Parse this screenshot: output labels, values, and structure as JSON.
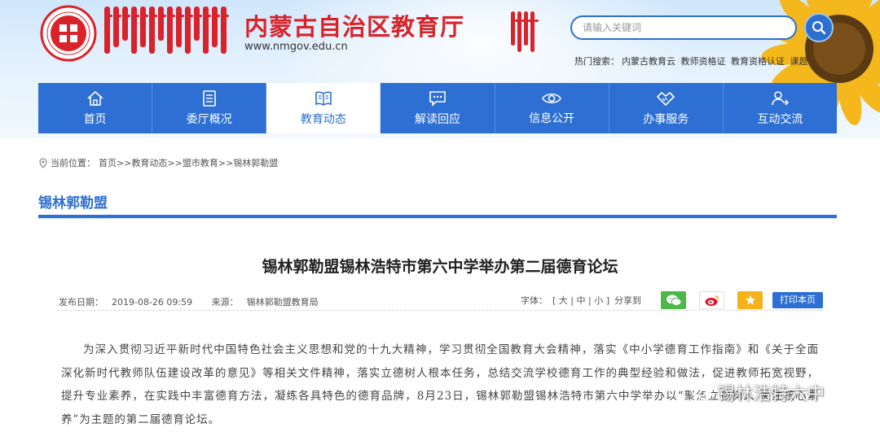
{
  "header": {
    "site_title": "内蒙古自治区教育厅",
    "site_url": "www.nmgov.edu.cn",
    "search_placeholder": "请输入关键词",
    "hot_search_label": "热门搜索：",
    "hot_search_items": [
      "内蒙古教育云",
      "教师资格证",
      "教育资格认证",
      "课题"
    ]
  },
  "nav": {
    "items": [
      {
        "label": "首页",
        "icon": "home-icon"
      },
      {
        "label": "委厅概况",
        "icon": "document-icon"
      },
      {
        "label": "教育动态",
        "icon": "book-icon",
        "active": true
      },
      {
        "label": "解读回应",
        "icon": "chat-icon"
      },
      {
        "label": "信息公开",
        "icon": "eye-icon"
      },
      {
        "label": "办事服务",
        "icon": "handshake-icon"
      },
      {
        "label": "互动交流",
        "icon": "user-exchange-icon"
      }
    ]
  },
  "breadcrumb": {
    "label": "当前位置：",
    "items": [
      "首页",
      ">>",
      "教育动态",
      ">>",
      "盟市教育",
      ">>",
      "锡林郭勒盟"
    ]
  },
  "section": {
    "title": "锡林郭勒盟"
  },
  "article": {
    "title": "锡林郭勒盟锡林浩特市第六中学举办第二届德育论坛",
    "publish_label": "发布日期：",
    "publish_date": "2019-08-26 09:59",
    "source_label": "来源：",
    "source": "锡林郭勒盟教育局",
    "font_label": "字体：",
    "font_sizes": [
      "[",
      "大",
      "|",
      "中",
      "|",
      "小",
      "]"
    ],
    "share_label": "分享到",
    "print_label": "打印本页",
    "paragraph": "为深入贯彻习近平新时代中国特色社会主义思想和党的十九大精神，学习贯彻全国教育大会精神，落实《中小学德育工作指南》和《关于全面深化新时代教师队伍建设改革的意见》等相关文件精神，落实立德树人根本任务，总结交流学校德育工作的典型经验和做法，促进教师拓宽视野，提升专业素养，在实践中丰富德育方法，凝练各具特色的德育品牌，8月23日，锡林郭勒盟锡林浩特市第六中学举办以“聚焦立德树人 关注核心素养”为主题的第二届德育论坛。"
  },
  "watermark": {
    "text": "锡林浩特六中"
  },
  "colors": {
    "primary": "#2d6fd2",
    "brand_red": "#d8232a"
  }
}
